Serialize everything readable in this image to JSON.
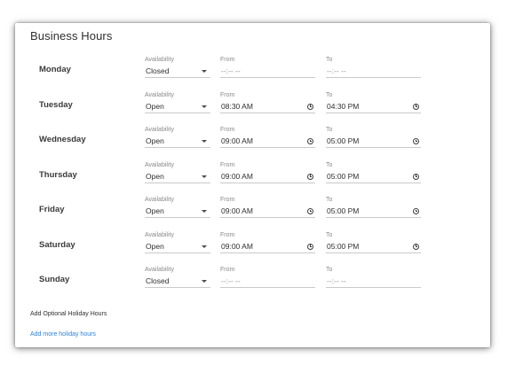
{
  "section_title": "Business Hours",
  "labels": {
    "availability": "Availability",
    "from": "From",
    "to": "To"
  },
  "days": [
    {
      "day": "Monday",
      "availability": "Closed",
      "from": "--:-- --",
      "to": "--:-- --",
      "from_is_placeholder": true,
      "to_is_placeholder": true
    },
    {
      "day": "Tuesday",
      "availability": "Open",
      "from": "08:30 AM",
      "to": "04:30 PM",
      "from_is_placeholder": false,
      "to_is_placeholder": false
    },
    {
      "day": "Wednesday",
      "availability": "Open",
      "from": "09:00 AM",
      "to": "05:00 PM",
      "from_is_placeholder": false,
      "to_is_placeholder": false
    },
    {
      "day": "Thursday",
      "availability": "Open",
      "from": "09:00 AM",
      "to": "05:00 PM",
      "from_is_placeholder": false,
      "to_is_placeholder": false
    },
    {
      "day": "Friday",
      "availability": "Open",
      "from": "09:00 AM",
      "to": "05:00 PM",
      "from_is_placeholder": false,
      "to_is_placeholder": false
    },
    {
      "day": "Saturday",
      "availability": "Open",
      "from": "09:00 AM",
      "to": "05:00 PM",
      "from_is_placeholder": false,
      "to_is_placeholder": false
    },
    {
      "day": "Sunday",
      "availability": "Closed",
      "from": "--:-- --",
      "to": "--:-- --",
      "from_is_placeholder": true,
      "to_is_placeholder": true
    }
  ],
  "holiday": {
    "optional_label": "Add Optional Holiday Hours",
    "add_link": "Add more holiday hours"
  },
  "colors": {
    "link": "#2d82d6",
    "card_shadow": "#000000"
  },
  "icons": {
    "time_picker": "clock-icon",
    "dropdown": "chevron-down-icon"
  }
}
